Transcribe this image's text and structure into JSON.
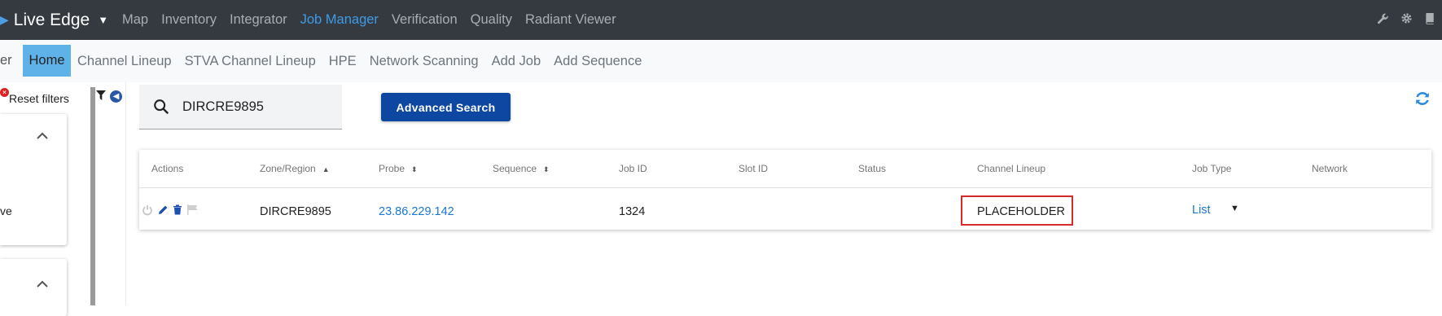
{
  "topbar": {
    "brand": "Live Edge",
    "nav": [
      "Map",
      "Inventory",
      "Integrator",
      "Job Manager",
      "Verification",
      "Quality",
      "Radiant Viewer"
    ],
    "active": "Job Manager",
    "icons": [
      "wrench-icon",
      "gear-icon",
      "book-icon"
    ]
  },
  "subnav": {
    "cut_label": "er",
    "home": "Home",
    "items": [
      "Channel Lineup",
      "STVA Channel Lineup",
      "HPE",
      "Network Scanning",
      "Add Job",
      "Add Sequence"
    ]
  },
  "filters": {
    "reset_label": "Reset filters",
    "card1_text": "ve"
  },
  "search": {
    "value": "DIRCRE9895",
    "advanced_label": "Advanced Search"
  },
  "table": {
    "headers": [
      "Actions",
      "Zone/Region",
      "Probe",
      "Sequence",
      "Job ID",
      "Slot ID",
      "Status",
      "Channel Lineup",
      "Job Type",
      "Network"
    ],
    "row": {
      "zone_region": "DIRCRE9895",
      "probe": "23.86.229.142",
      "sequence": "",
      "job_id": "1324",
      "slot_id": "",
      "status": "",
      "channel_lineup": "PLACEHOLDER",
      "job_type": "List",
      "network": ""
    }
  },
  "colors": {
    "topbar": "#343a40",
    "active_link": "#3f9be6",
    "home_tab": "#5fb2e8",
    "advanced_button": "#0d47a1",
    "highlight_border": "#d62b2b"
  }
}
